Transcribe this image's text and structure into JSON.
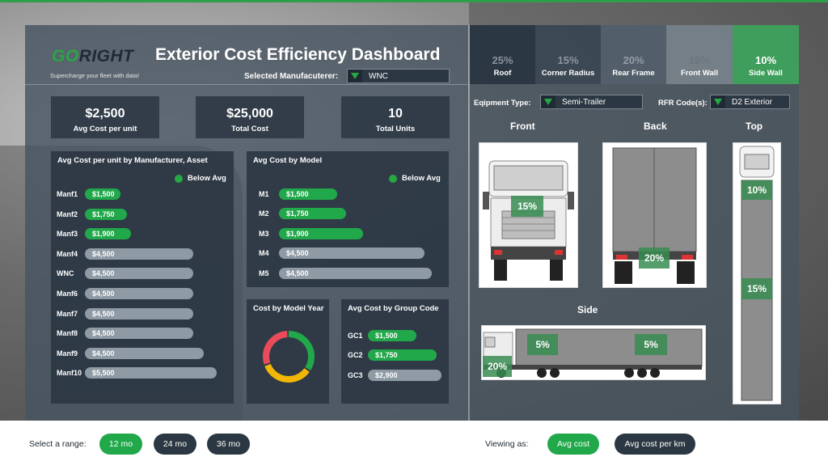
{
  "brand": {
    "go": "GO",
    "right": "RIGHT",
    "tagline": "Supercharge your fleet with data!"
  },
  "title": "Exterior Cost Efficiency Dashboard",
  "manufacturer": {
    "label": "Selected Manufacuterer:",
    "value": "WNC"
  },
  "kpis": [
    {
      "value": "$2,500",
      "label": "Avg Cost per unit"
    },
    {
      "value": "$25,000",
      "label": "Total Cost"
    },
    {
      "value": "10",
      "label": "Total Units"
    }
  ],
  "manufacturer_chart": {
    "title": "Avg Cost per unit by Manufacturer, Asset",
    "legend": "Below Avg",
    "rows": [
      {
        "label": "Manf1",
        "value": "$1,500",
        "below": true,
        "fill": 0.27
      },
      {
        "label": "Manf2",
        "value": "$1,750",
        "below": true,
        "fill": 0.32
      },
      {
        "label": "Manf3",
        "value": "$1,900",
        "below": true,
        "fill": 0.35
      },
      {
        "label": "Manf4",
        "value": "$4,500",
        "below": false,
        "fill": 0.82
      },
      {
        "label": "WNC",
        "value": "$4,500",
        "below": false,
        "fill": 0.82
      },
      {
        "label": "Manf6",
        "value": "$4,500",
        "below": false,
        "fill": 0.82
      },
      {
        "label": "Manf7",
        "value": "$4,500",
        "below": false,
        "fill": 0.82
      },
      {
        "label": "Manf8",
        "value": "$4,500",
        "below": false,
        "fill": 0.82
      },
      {
        "label": "Manf9",
        "value": "$4,500",
        "below": false,
        "fill": 0.9
      },
      {
        "label": "Manf10",
        "value": "$5,500",
        "below": false,
        "fill": 1.0
      }
    ]
  },
  "model_chart": {
    "title": "Avg Cost by Model",
    "legend": "Below Avg",
    "rows": [
      {
        "label": "M1",
        "value": "$1,500",
        "below": true,
        "fill": 0.38
      },
      {
        "label": "M2",
        "value": "$1,750",
        "below": true,
        "fill": 0.44
      },
      {
        "label": "M3",
        "value": "$1,900",
        "below": true,
        "fill": 0.55
      },
      {
        "label": "M4",
        "value": "$4,500",
        "below": false,
        "fill": 0.95
      },
      {
        "label": "M5",
        "value": "$4,500",
        "below": false,
        "fill": 1.0
      }
    ]
  },
  "year_chart": {
    "title": "Cost by Model Year",
    "colors": [
      "#21a84a",
      "#f2b705",
      "#e84b5a"
    ],
    "shares": [
      0.35,
      0.35,
      0.3
    ]
  },
  "group_chart": {
    "title": "Avg Cost by Group Code",
    "rows": [
      {
        "label": "GC1",
        "value": "$1,500",
        "below": true,
        "fill": 0.66
      },
      {
        "label": "GC2",
        "value": "$1,750",
        "below": true,
        "fill": 0.93
      },
      {
        "label": "GC3",
        "value": "$2,900",
        "below": false,
        "fill": 1.0
      }
    ]
  },
  "tabs": [
    {
      "pct": "25%",
      "name": "Roof",
      "active": false
    },
    {
      "pct": "15%",
      "name": "Corner Radius",
      "active": false
    },
    {
      "pct": "20%",
      "name": "Rear Frame",
      "active": false
    },
    {
      "pct": "10%",
      "name": "Front Wall",
      "active": false
    },
    {
      "pct": "10%",
      "name": "Side Wall",
      "active": true
    }
  ],
  "equipment": {
    "label": "Eqipment Type:",
    "value": "Semi-Trailer"
  },
  "rfr": {
    "label": "RFR Code(s):",
    "value": "D2 Exterior"
  },
  "views": {
    "front": "Front",
    "back": "Back",
    "top": "Top",
    "side": "Side"
  },
  "badges": {
    "front": "15%",
    "back": "20%",
    "top1": "10%",
    "top2": "15%",
    "side1": "5%",
    "side2": "5%",
    "side3": "20%"
  },
  "range": {
    "label": "Select a range:",
    "options": [
      "12 mo",
      "24 mo",
      "36 mo"
    ],
    "selected": "12 mo"
  },
  "viewing": {
    "label": "Viewing as:",
    "options": [
      "Avg cost",
      "Avg cost per km"
    ],
    "selected": "Avg cost"
  }
}
